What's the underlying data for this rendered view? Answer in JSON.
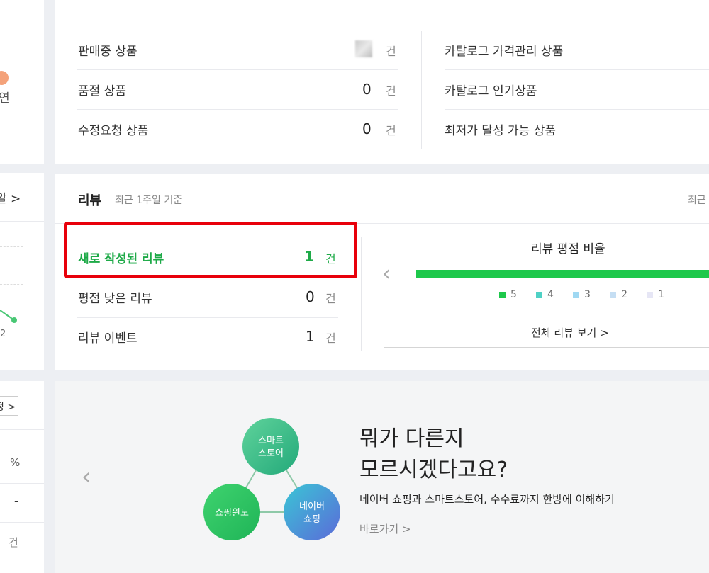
{
  "left_col": {
    "top_partial_text": "연",
    "mid_link_partial": "알 >",
    "chart_tick": "2",
    "bot_btn_partial": "정 >",
    "unit_percent": "%",
    "dash": "-",
    "unit_count": "건"
  },
  "products": {
    "items": [
      {
        "label": "판매중 상품",
        "value": "",
        "unit": "건"
      },
      {
        "label": "품절 상품",
        "value": "0",
        "unit": "건"
      },
      {
        "label": "수정요청 상품",
        "value": "0",
        "unit": "건"
      }
    ],
    "catalog": [
      {
        "label": "카탈로그 가격관리 상품"
      },
      {
        "label": "카탈로그 인기상품"
      },
      {
        "label": "최저가 달성 가능 상품"
      }
    ]
  },
  "review": {
    "title": "리뷰",
    "subtitle": "최근 1주일 기준",
    "right_partial": "최근",
    "items": [
      {
        "label": "새로 작성된 리뷰",
        "value": "1",
        "unit": "건"
      },
      {
        "label": "평점 낮은 리뷰",
        "value": "0",
        "unit": "건"
      },
      {
        "label": "리뷰 이벤트",
        "value": "1",
        "unit": "건"
      }
    ],
    "rating_title": "리뷰 평점 비율",
    "legend": [
      {
        "label": "5",
        "color": "#1ec84b"
      },
      {
        "label": "4",
        "color": "#4fd1c5"
      },
      {
        "label": "3",
        "color": "#9fd8f2"
      },
      {
        "label": "2",
        "color": "#c5def3"
      },
      {
        "label": "1",
        "color": "#e6e6f5"
      }
    ],
    "bar_color": "#1ec84b",
    "view_all": "전체 리뷰 보기 >"
  },
  "banner": {
    "headline_1": "뭐가 다른지",
    "headline_2": "모르시겠다고요?",
    "desc": "네이버 쇼핑과 스마트스토어, 수수료까지 한방에 이해하기",
    "link": "바로가기 >",
    "circle_top": "스마트\n스토어",
    "circle_left": "쇼핑윈도",
    "circle_right": "네이버\n쇼핑"
  },
  "highlight_color": "#e8000b"
}
